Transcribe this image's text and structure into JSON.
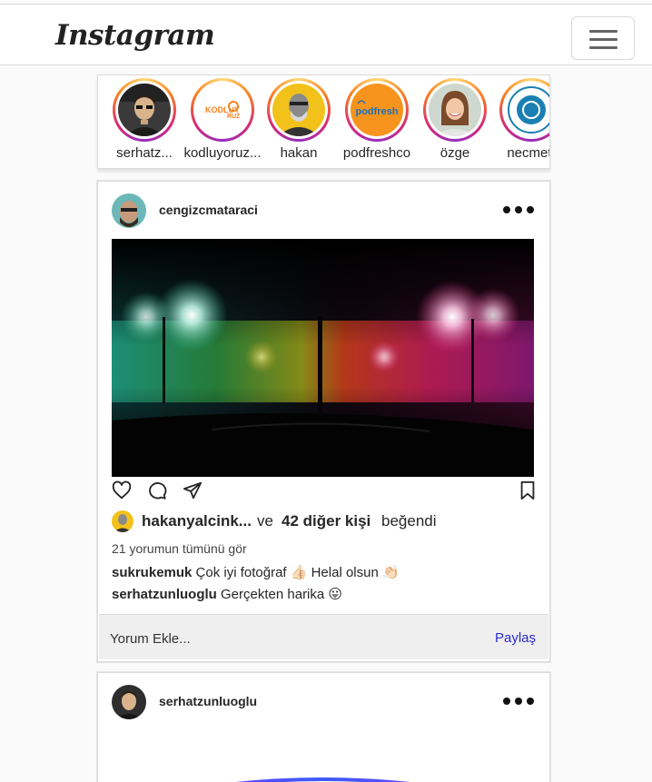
{
  "navbar": {
    "logo": "Instagram",
    "menu_icon": "hamburger-menu-icon"
  },
  "stories": [
    {
      "name": "serhatz..."
    },
    {
      "name": "kodluyoruz..."
    },
    {
      "name": "hakan"
    },
    {
      "name": "podfreshco"
    },
    {
      "name": "özge"
    },
    {
      "name": "necmett"
    }
  ],
  "story_logos": {
    "kodluyoruz_line1": "KODLUY",
    "kodluyoruz_line2": "RUZ",
    "podfresh": "podfresh"
  },
  "posts": [
    {
      "username": "cengizcmataraci",
      "liked_by": {
        "user": "hakanyalcink...",
        "connector": "ve",
        "others": "42 diğer kişi",
        "suffix": "beğendi"
      },
      "view_all_comments": "21 yorumun tümünü gör",
      "comments": [
        {
          "user": "sukrukemuk",
          "text": "Çok iyi fotoğraf 👍🏻  Helal olsun 👏🏻"
        },
        {
          "user": "serhatzunluoglu",
          "text": "Gerçekten harika 😛"
        }
      ],
      "add_comment_placeholder": "Yorum Ekle...",
      "share_label": "Paylaş"
    },
    {
      "username": "serhatzunluoglu"
    }
  ],
  "colors": {
    "story_ring": "#d62976",
    "share_link": "#2a2acf",
    "photo_left_glow": "#2fae8a",
    "photo_right_glow": "#d02a7a"
  },
  "icons": [
    "heart-icon",
    "comment-icon",
    "send-icon",
    "bookmark-icon",
    "more-options-icon"
  ]
}
